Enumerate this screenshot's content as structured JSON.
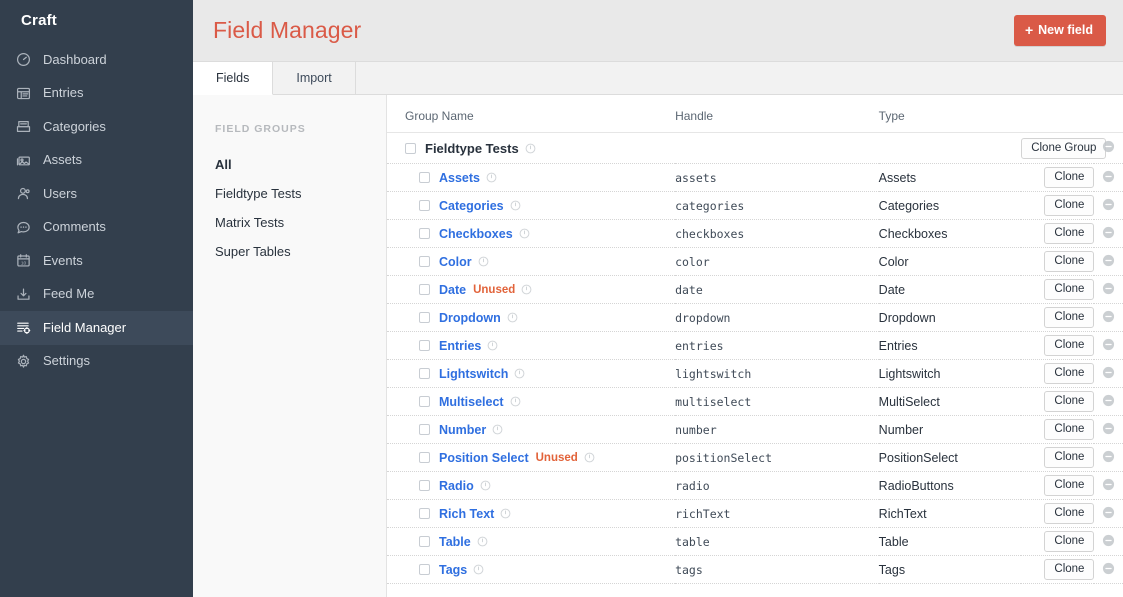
{
  "sidebar": {
    "brand": "Craft",
    "items": [
      {
        "label": "Dashboard",
        "icon": "gauge-icon",
        "active": false
      },
      {
        "label": "Entries",
        "icon": "entries-icon",
        "active": false
      },
      {
        "label": "Categories",
        "icon": "categories-icon",
        "active": false
      },
      {
        "label": "Assets",
        "icon": "assets-icon",
        "active": false
      },
      {
        "label": "Users",
        "icon": "users-icon",
        "active": false
      },
      {
        "label": "Comments",
        "icon": "comments-icon",
        "active": false
      },
      {
        "label": "Events",
        "icon": "calendar-icon",
        "active": false
      },
      {
        "label": "Feed Me",
        "icon": "download-icon",
        "active": false
      },
      {
        "label": "Field Manager",
        "icon": "field-manager-icon",
        "active": true
      },
      {
        "label": "Settings",
        "icon": "gear-icon",
        "active": false
      }
    ]
  },
  "header": {
    "title": "Field Manager",
    "new_field_label": "New field",
    "plus": "+",
    "accent_color": "#da5a47"
  },
  "tabs": [
    {
      "label": "Fields",
      "active": true
    },
    {
      "label": "Import",
      "active": false
    }
  ],
  "field_groups": {
    "title": "Field Groups",
    "items": [
      {
        "label": "All",
        "selected": true
      },
      {
        "label": "Fieldtype Tests",
        "selected": false
      },
      {
        "label": "Matrix Tests",
        "selected": false
      },
      {
        "label": "Super Tables",
        "selected": false
      }
    ]
  },
  "table": {
    "columns": [
      "Group Name",
      "Handle",
      "Type"
    ],
    "clone_group_label": "Clone Group",
    "clone_label": "Clone",
    "unused_label": "Unused",
    "group": {
      "name": "Fieldtype Tests"
    },
    "rows": [
      {
        "name": "Assets",
        "handle": "assets",
        "type": "Assets",
        "unused": false
      },
      {
        "name": "Categories",
        "handle": "categories",
        "type": "Categories",
        "unused": false
      },
      {
        "name": "Checkboxes",
        "handle": "checkboxes",
        "type": "Checkboxes",
        "unused": false
      },
      {
        "name": "Color",
        "handle": "color",
        "type": "Color",
        "unused": false
      },
      {
        "name": "Date",
        "handle": "date",
        "type": "Date",
        "unused": true
      },
      {
        "name": "Dropdown",
        "handle": "dropdown",
        "type": "Dropdown",
        "unused": false
      },
      {
        "name": "Entries",
        "handle": "entries",
        "type": "Entries",
        "unused": false
      },
      {
        "name": "Lightswitch",
        "handle": "lightswitch",
        "type": "Lightswitch",
        "unused": false
      },
      {
        "name": "Multiselect",
        "handle": "multiselect",
        "type": "MultiSelect",
        "unused": false
      },
      {
        "name": "Number",
        "handle": "number",
        "type": "Number",
        "unused": false
      },
      {
        "name": "Position Select",
        "handle": "positionSelect",
        "type": "PositionSelect",
        "unused": true
      },
      {
        "name": "Radio",
        "handle": "radio",
        "type": "RadioButtons",
        "unused": false
      },
      {
        "name": "Rich Text",
        "handle": "richText",
        "type": "RichText",
        "unused": false
      },
      {
        "name": "Table",
        "handle": "table",
        "type": "Table",
        "unused": false
      },
      {
        "name": "Tags",
        "handle": "tags",
        "type": "Tags",
        "unused": false
      }
    ]
  }
}
